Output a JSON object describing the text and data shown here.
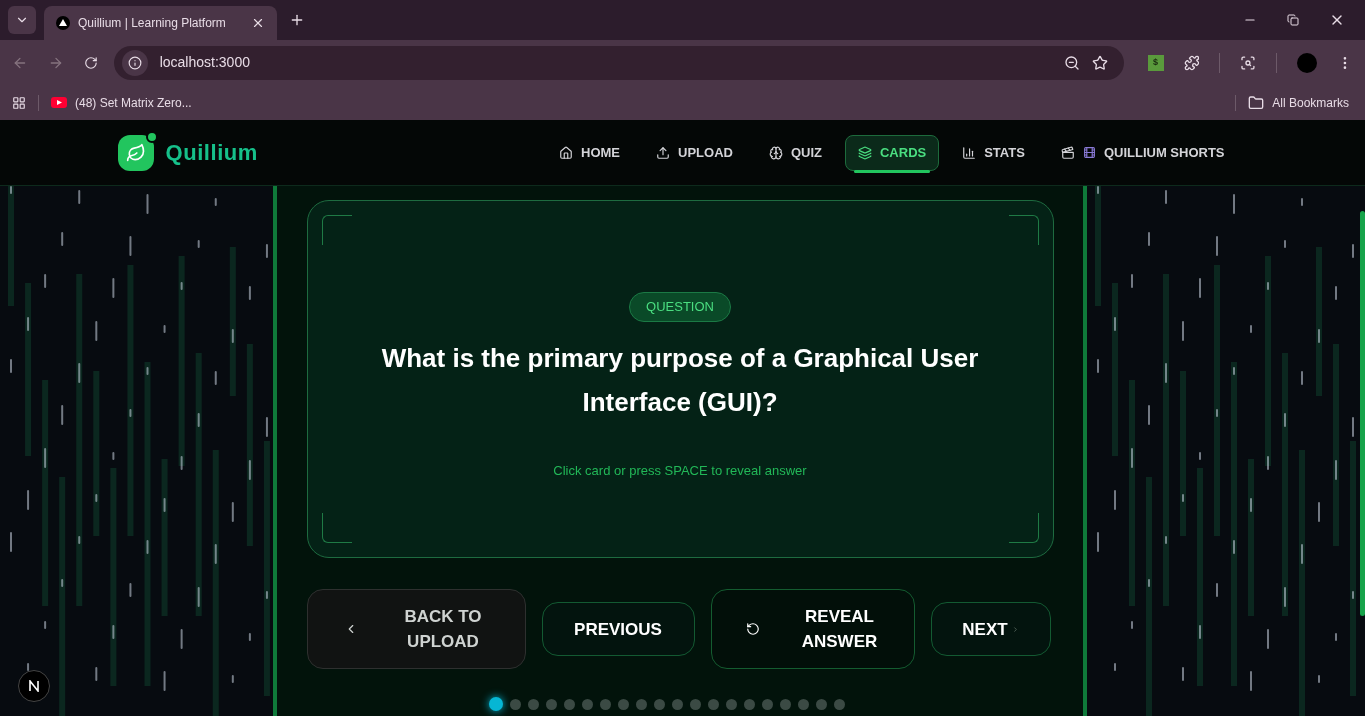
{
  "browser": {
    "tab": {
      "title": "Quillium | Learning Platform"
    },
    "back": {
      "disabled": true
    },
    "forward": {
      "disabled": true
    },
    "url": "localhost:3000",
    "bookmarks": [
      {
        "label": "(48) Set Matrix Zero..."
      }
    ],
    "all_bookmarks": "All Bookmarks",
    "extension_label": "$"
  },
  "header": {
    "brand": "Quillium",
    "nav": [
      {
        "label": "HOME",
        "kind": "home",
        "selected": false
      },
      {
        "label": "UPLOAD",
        "kind": "upload",
        "selected": false
      },
      {
        "label": "QUIZ",
        "kind": "brain",
        "selected": false
      },
      {
        "label": "CARDS",
        "kind": "layers",
        "selected": true
      },
      {
        "label": "STATS",
        "kind": "chart",
        "selected": false
      },
      {
        "label": "QUILLIUM SHORTS",
        "kind": "shorts",
        "selected": false
      }
    ]
  },
  "card": {
    "badge": "QUESTION",
    "question": "What is the primary purpose of a Graphical User Interface (GUI)?",
    "hint": "Click card or press SPACE to reveal answer"
  },
  "buttons": [
    {
      "label": "BACK TO UPLOAD",
      "kind": "back"
    },
    {
      "label": "PREVIOUS",
      "kind": "previous"
    },
    {
      "label": "REVEAL ANSWER",
      "kind": "reveal"
    },
    {
      "label": "NEXT",
      "kind": "next"
    }
  ],
  "progress_dots": [
    {
      "selected": true
    },
    {
      "selected": false
    },
    {
      "selected": false
    },
    {
      "selected": false
    },
    {
      "selected": false
    },
    {
      "selected": false
    },
    {
      "selected": false
    },
    {
      "selected": false
    },
    {
      "selected": false
    },
    {
      "selected": false
    },
    {
      "selected": false
    },
    {
      "selected": false
    },
    {
      "selected": false
    },
    {
      "selected": false
    },
    {
      "selected": false
    },
    {
      "selected": false
    },
    {
      "selected": false
    },
    {
      "selected": false
    },
    {
      "selected": false
    },
    {
      "selected": false
    }
  ]
}
